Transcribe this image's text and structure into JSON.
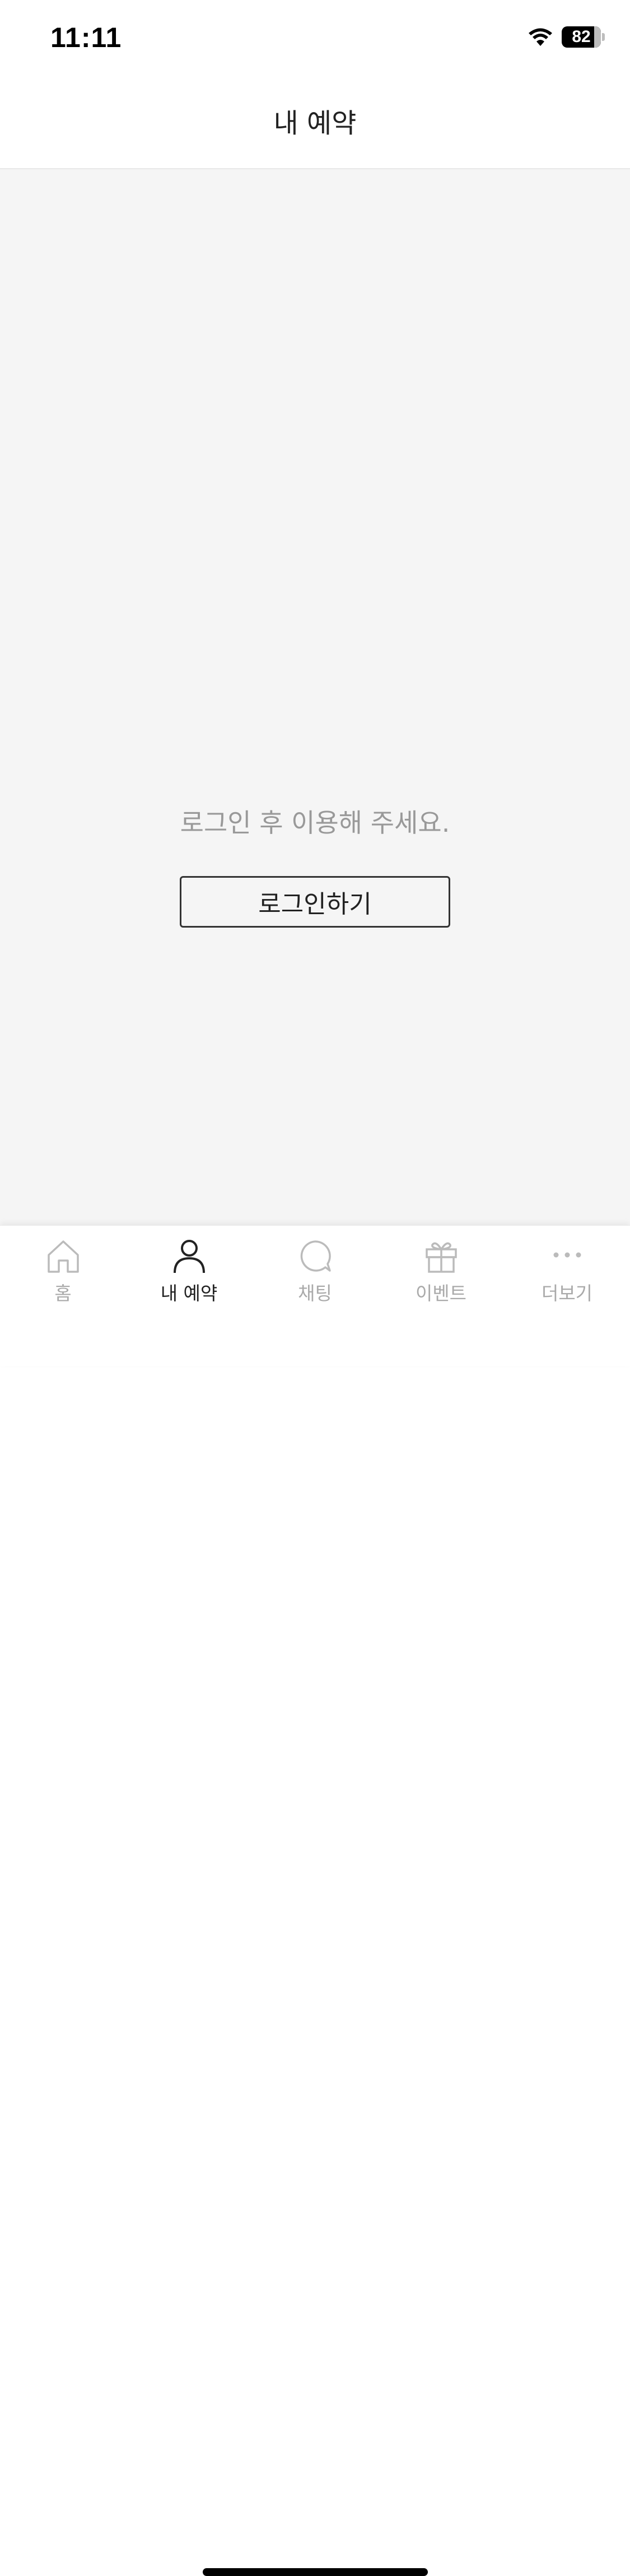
{
  "status_bar": {
    "time": "11:11",
    "battery_level": "82",
    "battery_percent": 82,
    "icons": [
      "wifi-icon",
      "battery-icon"
    ]
  },
  "header": {
    "title": "내 예약"
  },
  "main": {
    "message": "로그인 후 이용해 주세요.",
    "login_button_label": "로그인하기"
  },
  "tab_bar": {
    "active_index": 1,
    "tabs": [
      {
        "label": "홈",
        "icon": "home-icon"
      },
      {
        "label": "내 예약",
        "icon": "person-icon"
      },
      {
        "label": "채팅",
        "icon": "chat-icon"
      },
      {
        "label": "이벤트",
        "icon": "gift-icon"
      },
      {
        "label": "더보기",
        "icon": "more-icon"
      }
    ]
  },
  "colors": {
    "background": "#f5f5f5",
    "active_tab": "#222222",
    "inactive_tab": "#aaaaaa",
    "message_text": "#999999"
  }
}
